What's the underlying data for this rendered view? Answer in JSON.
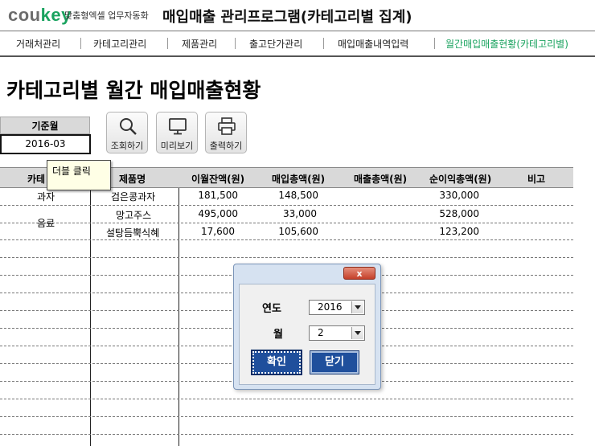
{
  "header": {
    "logo_prefix": "cou",
    "logo_suffix": "key",
    "tagline": "맞춤형엑셀 업무자동화",
    "title": "매입매출 관리프로그램(카테고리별 집계)"
  },
  "nav": {
    "items": [
      {
        "label": "거래처관리"
      },
      {
        "label": "카테고리관리"
      },
      {
        "label": "제품관리"
      },
      {
        "label": "출고단가관리"
      },
      {
        "label": "매입매출내역입력"
      },
      {
        "label": "월간매입매출현황(카테고리별)"
      }
    ],
    "active_color": "#1aa35f"
  },
  "page_title": "카테고리별 월간 매입매출현황",
  "base_month": {
    "label": "기준월",
    "value": "2016-03"
  },
  "toolbar": {
    "search_label": "조회하기",
    "preview_label": "미리보기",
    "print_label": "출력하기"
  },
  "table": {
    "headers": [
      "카테",
      "제품명",
      "이월잔액(원)",
      "매입총액(원)",
      "매출총액(원)",
      "순이익총액(원)",
      "비고"
    ],
    "categories": [
      "과자",
      "음료"
    ],
    "rows": [
      {
        "product": "검은콩과자",
        "carryover": "181,500",
        "purchase": "148,500",
        "sales": "",
        "profit": "330,000"
      },
      {
        "product": "망고주스",
        "carryover": "495,000",
        "purchase": "33,000",
        "sales": "",
        "profit": "528,000"
      },
      {
        "product": "설탕듬뿍식혜",
        "carryover": "17,600",
        "purchase": "105,600",
        "sales": "",
        "profit": "123,200"
      }
    ]
  },
  "tooltip": {
    "text": "더블 클릭"
  },
  "dialog": {
    "close_glyph": "x",
    "year_label": "연도",
    "year_value": "2016",
    "month_label": "월",
    "month_value": "2",
    "ok_label": "확인",
    "close_label": "닫기"
  }
}
